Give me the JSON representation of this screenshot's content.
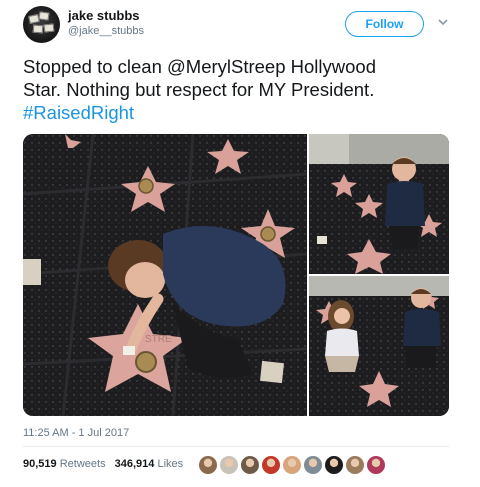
{
  "user": {
    "display_name": "jake stubbs",
    "handle": "@jake__stubbs",
    "avatar_icon": "profile-avatar-icon"
  },
  "follow": {
    "label": "Follow",
    "caret_icon": "chevron-down-icon"
  },
  "tweet": {
    "line1": "Stopped to clean @MerylStreep Hollywood",
    "line2": "Star. Nothing but respect for MY President.",
    "hashtag": "#RaisedRight"
  },
  "media": {
    "main": {
      "star_text": "STRE"
    },
    "photos": [
      "photo-main",
      "photo-top-right",
      "photo-bottom-right"
    ]
  },
  "meta": {
    "timestamp": "11:25 AM - 1 Jul 2017"
  },
  "stats": {
    "retweets_count": "90,519",
    "retweets_label": "Retweets",
    "likes_count": "346,914",
    "likes_label": "Likes"
  },
  "likers": [
    {
      "color": "#8b6a4e"
    },
    {
      "color": "#c9c2b8"
    },
    {
      "color": "#6e5a49"
    },
    {
      "color": "#c0392b"
    },
    {
      "color": "#d8a47a"
    },
    {
      "color": "#7f8c96"
    },
    {
      "color": "#1c1c1c"
    },
    {
      "color": "#9a7b5c"
    },
    {
      "color": "#b03a5b"
    }
  ],
  "colors": {
    "link": "#1b95e0",
    "follow": "#1da1f2",
    "muted": "#657786",
    "star": "#e0a6a0"
  }
}
